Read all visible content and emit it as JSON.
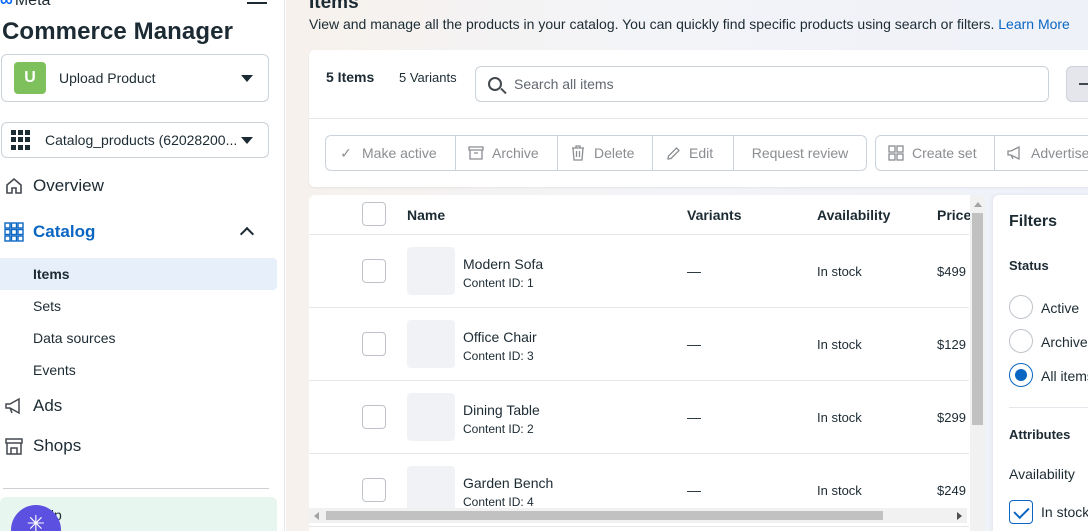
{
  "brand": {
    "logo_text": "Meta",
    "app_title": "Commerce Manager"
  },
  "sidebar": {
    "upload_picker": {
      "badge": "U",
      "label": "Upload Product"
    },
    "catalog_picker": {
      "label": "Catalog_products (62028200..."
    },
    "nav": [
      {
        "label": "Overview",
        "icon": "home-icon"
      },
      {
        "label": "Catalog",
        "icon": "catalog-grid-icon",
        "active": true
      },
      {
        "label": "Ads",
        "icon": "megaphone-icon"
      },
      {
        "label": "Shops",
        "icon": "shop-icon"
      }
    ],
    "catalog_sub": [
      {
        "label": "Items",
        "selected": true
      },
      {
        "label": "Sets"
      },
      {
        "label": "Data sources"
      },
      {
        "label": "Events"
      }
    ],
    "help_label": "Help"
  },
  "page": {
    "title": "Items",
    "description": "View and manage all the products in your catalog. You can quickly find specific products using search or filters.",
    "learn_more": "Learn More"
  },
  "toolbar": {
    "items_count": "5 Items",
    "variants_count": "5 Variants",
    "search_placeholder": "Search all items",
    "actions": {
      "make_active": "Make active",
      "archive": "Archive",
      "delete": "Delete",
      "edit": "Edit",
      "request_review": "Request review",
      "create_set": "Create set",
      "advertise": "Advertise"
    }
  },
  "table": {
    "columns": {
      "name": "Name",
      "variants": "Variants",
      "availability": "Availability",
      "price": "Price"
    },
    "rows": [
      {
        "name": "Modern Sofa",
        "content_id": "Content ID: 1",
        "variants": "—",
        "availability": "In stock",
        "price": "$499"
      },
      {
        "name": "Office Chair",
        "content_id": "Content ID: 3",
        "variants": "—",
        "availability": "In stock",
        "price": "$129"
      },
      {
        "name": "Dining Table",
        "content_id": "Content ID: 2",
        "variants": "—",
        "availability": "In stock",
        "price": "$299"
      },
      {
        "name": "Garden Bench",
        "content_id": "Content ID: 4",
        "variants": "—",
        "availability": "In stock",
        "price": "$249"
      }
    ]
  },
  "filters": {
    "title": "Filters",
    "status_heading": "Status",
    "status_options": [
      {
        "label": "Active",
        "selected": false
      },
      {
        "label": "Archived",
        "selected": false
      },
      {
        "label": "All items",
        "selected": true
      }
    ],
    "attributes_heading": "Attributes",
    "availability_label": "Availability",
    "in_stock_label": "In stock",
    "in_stock_checked": true
  },
  "colors": {
    "accent": "#0a66c2",
    "upload_badge": "#7ec05b",
    "help_badge": "#5b50e0"
  }
}
